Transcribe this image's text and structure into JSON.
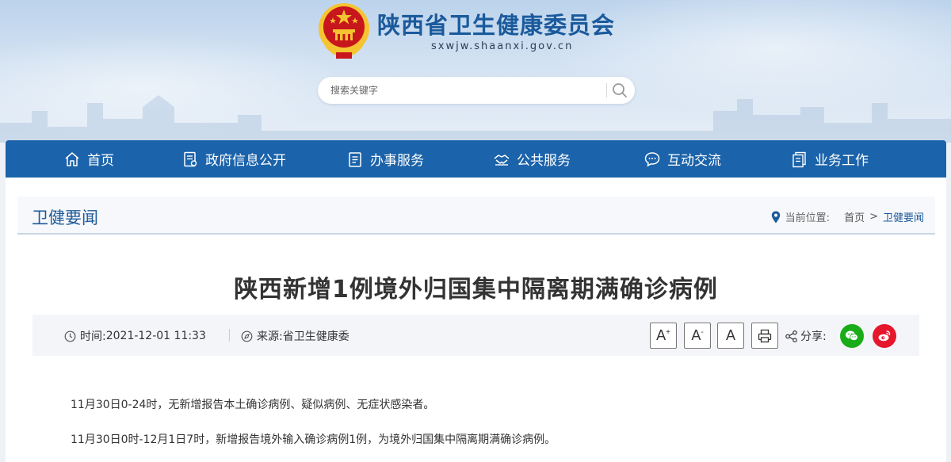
{
  "header": {
    "site_title": "陕西省卫生健康委员会",
    "site_domain": "sxwjw.shaanxi.gov.cn",
    "search_placeholder": "搜索关键字"
  },
  "nav": {
    "items": [
      {
        "label": "首页",
        "icon": "home-icon"
      },
      {
        "label": "政府信息公开",
        "icon": "document-list-icon"
      },
      {
        "label": "办事服务",
        "icon": "clipboard-icon"
      },
      {
        "label": "公共服务",
        "icon": "handshake-icon"
      },
      {
        "label": "互动交流",
        "icon": "chat-bubble-icon"
      },
      {
        "label": "业务工作",
        "icon": "folder-stack-icon"
      }
    ]
  },
  "section": {
    "title": "卫健要闻",
    "location_label": "当前位置:",
    "breadcrumb_home": "首页",
    "breadcrumb_arrow": ">",
    "breadcrumb_current": "卫健要闻"
  },
  "article": {
    "title": "陕西新增1例境外归国集中隔离期满确诊病例",
    "time_label": "时间:",
    "time_value": "2021-12-01 11:33",
    "source_label": "来源:",
    "source_value": "省卫生健康委",
    "font_large": "A",
    "font_large_sup": "+",
    "font_small": "A",
    "font_small_sup": "-",
    "font_reset": "A",
    "share_label": "分享:",
    "paragraphs": [
      "11月30日0-24时，无新增报告本土确诊病例、疑似病例、无症状感染者。",
      "11月30日0时-12月1日7时，新增报告境外输入确诊病例1例，为境外归国集中隔离期满确诊病例。"
    ]
  },
  "colors": {
    "brand_blue": "#1b63aa",
    "title_blue": "#1a5a9c",
    "wechat_green": "#1aad19",
    "weibo_red": "#e6162d",
    "emblem_red": "#c8161d",
    "emblem_gold": "#f5c431"
  }
}
